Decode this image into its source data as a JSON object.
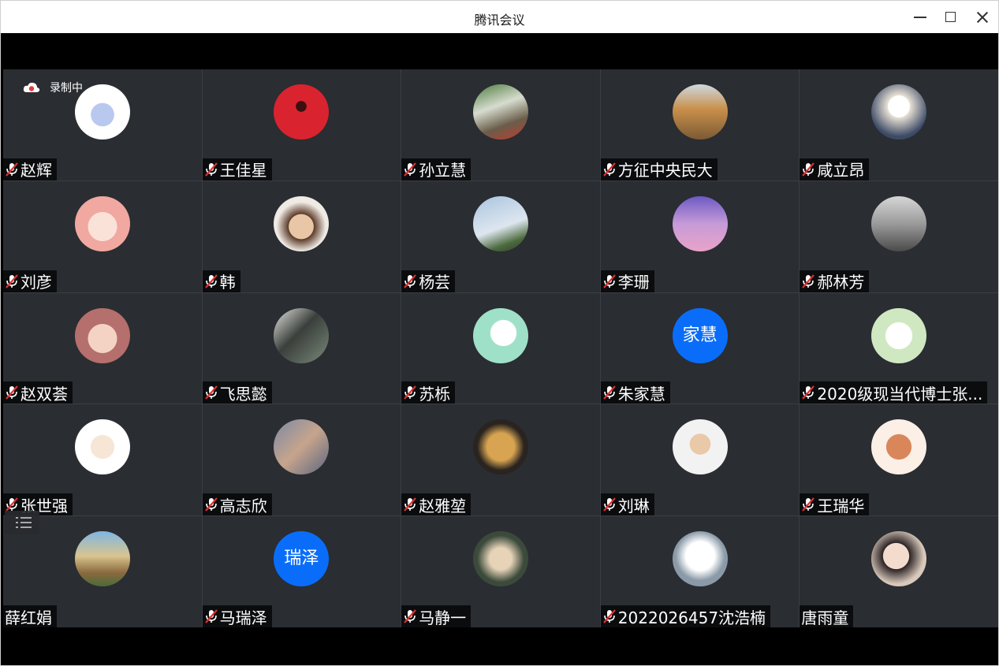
{
  "window": {
    "title": "腾讯会议",
    "controls": [
      "minimize-icon",
      "maximize-icon",
      "close-icon"
    ]
  },
  "recording": {
    "label": "录制中",
    "icon": "cloud-record-icon",
    "dot_color": "#e63946"
  },
  "accent_color": "#0a6dfa",
  "participants": [
    {
      "name": "赵辉",
      "muted": true,
      "avatar": "whale-cartoon-avatar"
    },
    {
      "name": "王佳星",
      "muted": true,
      "avatar": "red-logo-avatar"
    },
    {
      "name": "孙立慧",
      "muted": true,
      "avatar": "flower-vase-photo-avatar"
    },
    {
      "name": "方征中央民大",
      "muted": true,
      "avatar": "tent-autumn-photo-avatar"
    },
    {
      "name": "咸立昂",
      "muted": true,
      "avatar": "sketch-character-avatar"
    },
    {
      "name": "刘彦",
      "muted": true,
      "avatar": "anime-girl-glasses-avatar"
    },
    {
      "name": "韩",
      "muted": true,
      "avatar": "girl-portrait-avatar"
    },
    {
      "name": "杨芸",
      "muted": true,
      "avatar": "sky-mountain-photo-avatar"
    },
    {
      "name": "李珊",
      "muted": true,
      "avatar": "purple-sky-building-avatar"
    },
    {
      "name": "郝林芳",
      "muted": true,
      "avatar": "ink-landscape-avatar"
    },
    {
      "name": "赵双荟",
      "muted": true,
      "avatar": "pink-bunny-cartoon-avatar"
    },
    {
      "name": "飞思懿",
      "muted": true,
      "avatar": "ink-painting-avatar"
    },
    {
      "name": "苏栎",
      "muted": true,
      "avatar": "cat-mint-cartoon-avatar"
    },
    {
      "name": "朱家慧",
      "muted": true,
      "avatar": "text-avatar",
      "avatar_text": "家慧"
    },
    {
      "name": "2020级现当代博士张...",
      "muted": true,
      "avatar": "bear-cartoon-avatar"
    },
    {
      "name": "张世强",
      "muted": true,
      "avatar": "man-cartoon-avatar"
    },
    {
      "name": "高志欣",
      "muted": true,
      "avatar": "cloud-sky-photo-avatar"
    },
    {
      "name": "赵雅堃",
      "muted": true,
      "avatar": "lion-plush-avatar"
    },
    {
      "name": "刘琳",
      "muted": true,
      "avatar": "child-photo-avatar"
    },
    {
      "name": "王瑞华",
      "muted": true,
      "avatar": "orange-bear-cartoon-avatar"
    },
    {
      "name": "薛红娟",
      "muted": false,
      "avatar": "castle-town-photo-avatar"
    },
    {
      "name": "马瑞泽",
      "muted": true,
      "avatar": "text-avatar",
      "avatar_text": "瑞泽"
    },
    {
      "name": "马静一",
      "muted": true,
      "avatar": "painted-child-avatar"
    },
    {
      "name": "2022026457沈浩楠",
      "muted": true,
      "avatar": "cool-cat-sunglasses-avatar"
    },
    {
      "name": "唐雨童",
      "muted": false,
      "avatar": "girl-selfie-avatar"
    }
  ]
}
